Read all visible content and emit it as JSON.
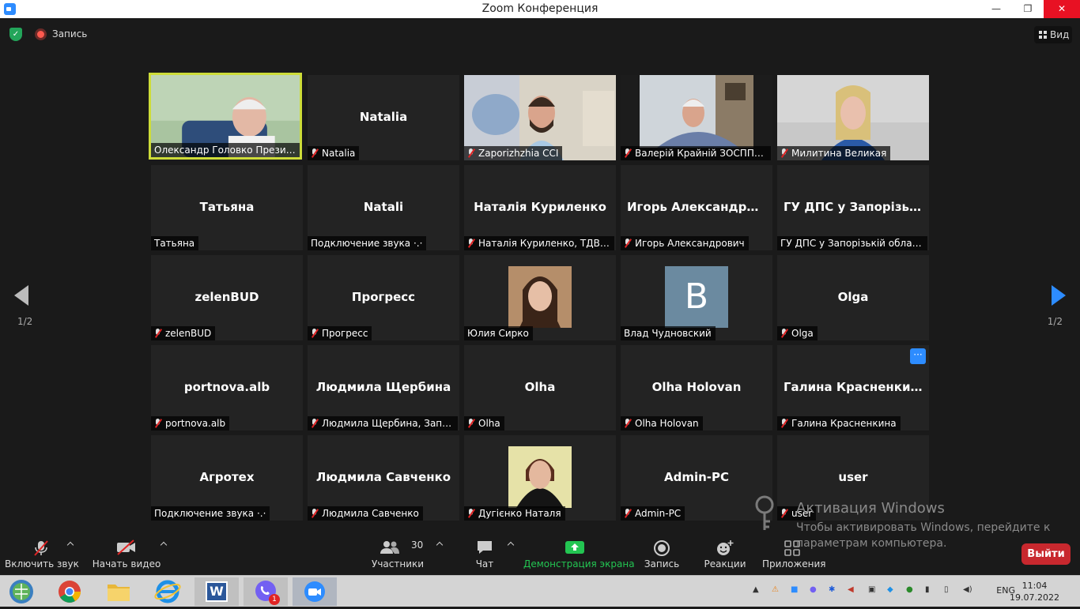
{
  "window": {
    "title": "Zoom Конференция",
    "minimize": "—",
    "restore": "❐",
    "close": "✕"
  },
  "topbar": {
    "recording_label": "Запись",
    "view_label": "Вид"
  },
  "pagination": {
    "left_label": "1/2",
    "right_label": "1/2"
  },
  "tiles": [
    {
      "name": "",
      "label": "Олександр Головко  Президент ТПП",
      "muted": false,
      "type": "video"
    },
    {
      "name": "Natalia",
      "label": "Natalia",
      "muted": true,
      "type": "name"
    },
    {
      "name": "",
      "label": "Zaporizhzhia CCI",
      "muted": true,
      "type": "video"
    },
    {
      "name": "",
      "label": "Валерій Крайній ЗОСППР ...",
      "muted": true,
      "type": "video"
    },
    {
      "name": "",
      "label": "Милитина Великая",
      "muted": true,
      "type": "video"
    },
    {
      "name": "Татьяна",
      "label": "Татьяна",
      "muted": false,
      "type": "name"
    },
    {
      "name": "Natali",
      "label": "Подключение звука ·.·",
      "muted": false,
      "type": "name"
    },
    {
      "name": "Наталія  Куриленко",
      "label": "Наталія Куриленко, ТДВ \"...",
      "muted": true,
      "type": "name"
    },
    {
      "name": "Игорь  Александрович",
      "label": "Игорь Александрович",
      "muted": true,
      "type": "name"
    },
    {
      "name": "ГУ ДПС у Запорізькій",
      "label": "ГУ ДПС у Запорізькій області",
      "muted": false,
      "type": "name"
    },
    {
      "name": "zelenBUD",
      "label": "zelenBUD",
      "muted": true,
      "type": "name"
    },
    {
      "name": "Прогресс",
      "label": "Прогресс",
      "muted": true,
      "type": "name"
    },
    {
      "name": "",
      "label": "Юлия Сирко",
      "muted": false,
      "type": "photo1"
    },
    {
      "name": "",
      "label": "Влад Чудновский",
      "muted": false,
      "type": "avatar",
      "avatar_letter": "B"
    },
    {
      "name": "Olga",
      "label": "Olga",
      "muted": true,
      "type": "name"
    },
    {
      "name": "portnova.alb",
      "label": "portnova.alb",
      "muted": true,
      "type": "name"
    },
    {
      "name": "Людмила  Щербина",
      "label": "Людмила Щербина, Запо...",
      "muted": true,
      "type": "name"
    },
    {
      "name": "Olha",
      "label": "Olha",
      "muted": true,
      "type": "name"
    },
    {
      "name": "Olha Holovan",
      "label": "Olha Holovan",
      "muted": true,
      "type": "name"
    },
    {
      "name": "Галина  Красненкина",
      "label": "Галина Красненкина",
      "muted": true,
      "type": "name",
      "more": "···"
    },
    {
      "name": "Агротех",
      "label": "Подключение звука ·.·",
      "muted": false,
      "type": "name"
    },
    {
      "name": "Людмила  Савченко",
      "label": "Людмила Савченко",
      "muted": true,
      "type": "name"
    },
    {
      "name": "",
      "label": "Дугієнко Наталя",
      "muted": true,
      "type": "photo2"
    },
    {
      "name": "Admin-PC",
      "label": "Admin-PC",
      "muted": true,
      "type": "name"
    },
    {
      "name": "user",
      "label": "user",
      "muted": true,
      "type": "name"
    }
  ],
  "toolbar": {
    "unmute": "Включить звук",
    "start_video": "Начать видео",
    "participants": "Участники",
    "participants_count": "30",
    "chat": "Чат",
    "share_screen": "Демонстрация экрана",
    "record": "Запись",
    "reactions": "Реакции",
    "apps": "Приложения",
    "leave": "Выйти"
  },
  "watermark": {
    "line1": "Активация Windows",
    "line2": "Чтобы активировать Windows, перейдите к",
    "line3": "параметрам компьютера."
  },
  "taskbar": {
    "lang": "ENG",
    "time": "11:04",
    "date": "19.07.2022",
    "viber_badge": "1",
    "word_letter": "W"
  },
  "colors": {
    "accent": "#2d8cff",
    "active_speaker": "#cddc39",
    "leave": "#c8282e",
    "share": "#23c552"
  }
}
